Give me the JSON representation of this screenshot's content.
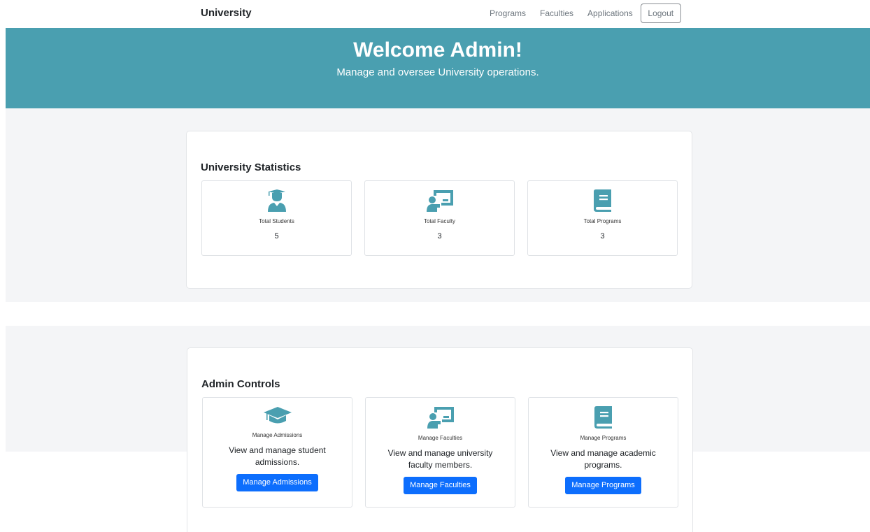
{
  "navbar": {
    "brand": "University",
    "links": [
      "Programs",
      "Faculties",
      "Applications"
    ],
    "logout_label": "Logout"
  },
  "hero": {
    "title": "Welcome Admin!",
    "subtitle": "Manage and oversee University operations."
  },
  "statistics": {
    "title": "University Statistics",
    "cards": [
      {
        "icon": "graduate-student-icon",
        "label": "Total Students",
        "value": "5"
      },
      {
        "icon": "faculty-teacher-icon",
        "label": "Total Faculty",
        "value": "3"
      },
      {
        "icon": "book-icon",
        "label": "Total Programs",
        "value": "3"
      }
    ]
  },
  "controls": {
    "title": "Admin Controls",
    "cards": [
      {
        "icon": "graduation-cap-icon",
        "label": "Manage Admissions",
        "description": "View and manage student admissions.",
        "button": "Manage Admissions"
      },
      {
        "icon": "faculty-teacher-icon",
        "label": "Manage Faculties",
        "description": "View and manage university faculty members.",
        "button": "Manage Faculties"
      },
      {
        "icon": "book-icon",
        "label": "Manage Programs",
        "description": "View and manage academic programs.",
        "button": "Manage Programs"
      }
    ]
  },
  "colors": {
    "accent": "#4a9fb0",
    "button": "#0d6efd",
    "band": "#f4f5f7"
  }
}
